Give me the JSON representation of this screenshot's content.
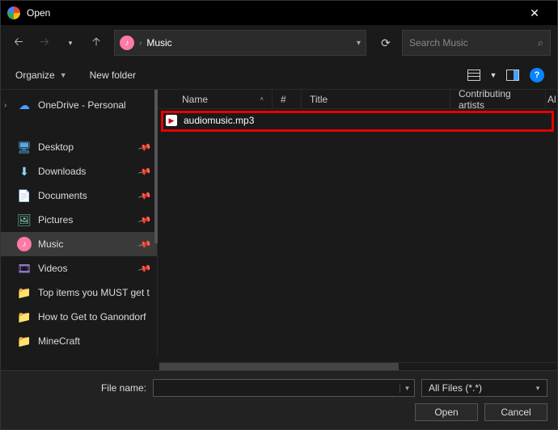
{
  "titlebar": {
    "title": "Open"
  },
  "nav": {
    "back_enabled": true,
    "forward_enabled": false
  },
  "address": {
    "location": "Music"
  },
  "search": {
    "placeholder": "Search Music"
  },
  "toolbar": {
    "organize_label": "Organize",
    "newfolder_label": "New folder"
  },
  "sidebar": {
    "items": [
      {
        "label": "OneDrive - Personal",
        "icon": "cloud",
        "expandable": true,
        "pin": false
      },
      {
        "gap": true
      },
      {
        "label": "Desktop",
        "icon": "desktop",
        "pin": true
      },
      {
        "label": "Downloads",
        "icon": "download",
        "pin": true
      },
      {
        "label": "Documents",
        "icon": "document",
        "pin": true
      },
      {
        "label": "Pictures",
        "icon": "pictures",
        "pin": true
      },
      {
        "label": "Music",
        "icon": "music",
        "pin": true,
        "selected": true
      },
      {
        "label": "Videos",
        "icon": "videos",
        "pin": true
      },
      {
        "label": "Top items you MUST get t",
        "icon": "folder",
        "pin": false
      },
      {
        "label": "How to Get to Ganondorf",
        "icon": "folder",
        "pin": false
      },
      {
        "label": "MineCraft",
        "icon": "folder",
        "pin": false
      }
    ]
  },
  "columns": {
    "name": "Name",
    "num": "#",
    "title": "Title",
    "artists": "Contributing artists",
    "clipped": "Al"
  },
  "files": [
    {
      "name": "audiomusic.mp3"
    }
  ],
  "footer": {
    "filename_label": "File name:",
    "filename_value": "",
    "filter": "All Files (*.*)",
    "open_label": "Open",
    "cancel_label": "Cancel"
  }
}
